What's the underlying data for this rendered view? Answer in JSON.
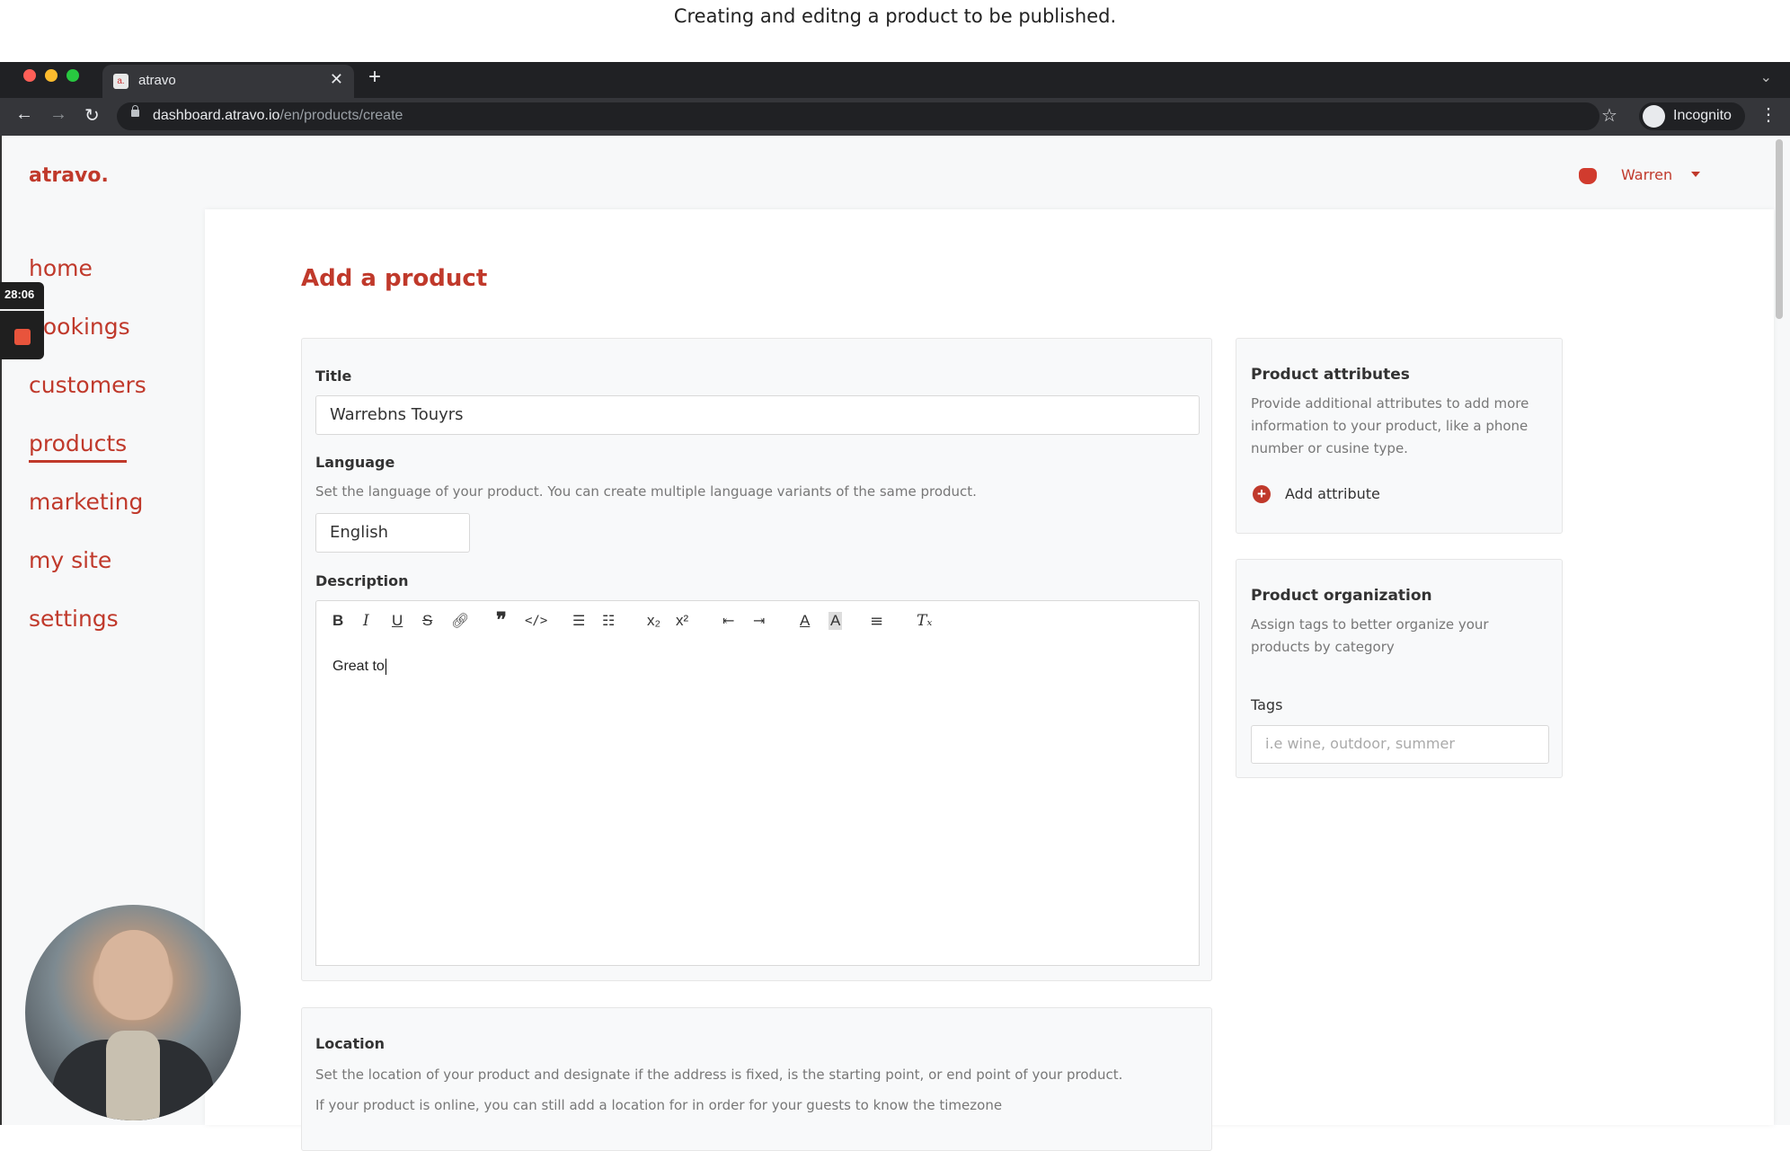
{
  "caption": "Creating and editng a product to be published.",
  "browser": {
    "tab_title": "atravo",
    "favicon_text": "a.",
    "url_host": "dashboard.atravo.io",
    "url_path": "/en/products/create",
    "profile_label": "Incognito"
  },
  "header": {
    "logo": "atravo.",
    "user_name": "Warren"
  },
  "sidebar": {
    "items": [
      {
        "label": "home"
      },
      {
        "label": "bookings"
      },
      {
        "label": "customers"
      },
      {
        "label": "products"
      },
      {
        "label": "marketing"
      },
      {
        "label": "my site"
      },
      {
        "label": "settings"
      }
    ]
  },
  "recording": {
    "elapsed": "28:06"
  },
  "main": {
    "page_title": "Add a product",
    "title_label": "Title",
    "title_value": "Warrebns Touyrs",
    "language_label": "Language",
    "language_help": "Set the language of your product. You can create multiple language variants of the same product.",
    "language_value": "English",
    "description_label": "Description",
    "description_text": "Great to",
    "location_label": "Location",
    "location_help_1": "Set the location of your product and designate if the address is fixed, is the starting point, or end point of your product.",
    "location_help_2": "If your product is online, you can still add a location for in order for your guests to know the timezone"
  },
  "attributes": {
    "heading": "Product attributes",
    "help": "Provide additional attributes to add more information to your product, like a phone number or cusine type.",
    "add_label": "Add attribute"
  },
  "organization": {
    "heading": "Product organization",
    "help": "Assign tags to better organize your products by category",
    "tags_label": "Tags",
    "tags_placeholder": "i.e wine, outdoor, summer"
  },
  "colors": {
    "brand": "#c0392b"
  }
}
